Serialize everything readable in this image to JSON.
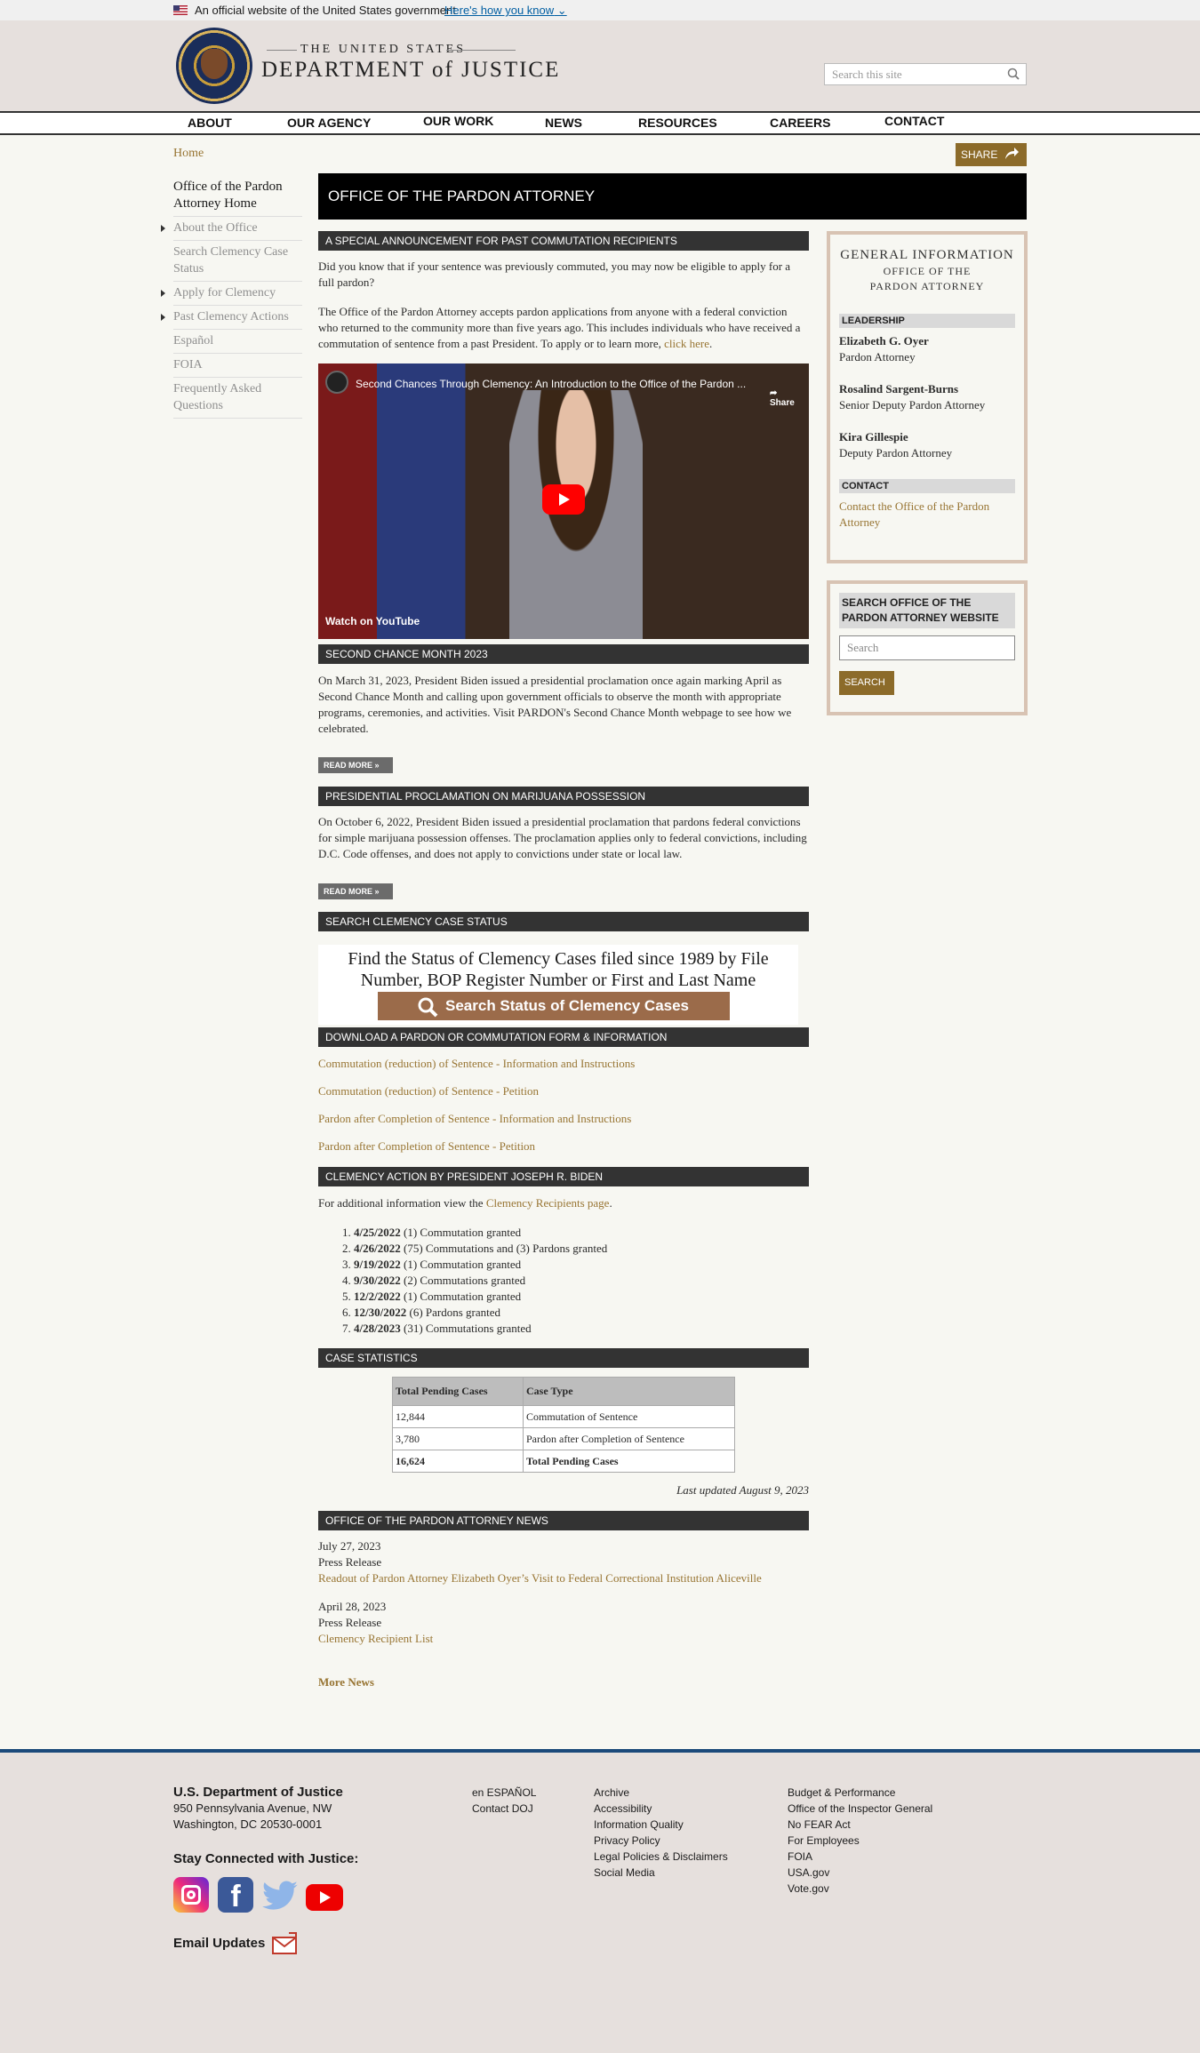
{
  "banner": {
    "text": "An official website of the United States government",
    "how": "Here's how you know"
  },
  "header": {
    "line1": "THE UNITED STATES",
    "line2": "DEPARTMENT of JUSTICE",
    "search_placeholder": "Search this site"
  },
  "nav": [
    "ABOUT",
    "OUR AGENCY",
    "OUR WORK",
    "NEWS",
    "RESOURCES",
    "CAREERS",
    "CONTACT"
  ],
  "breadcrumb": "Home",
  "share": "SHARE",
  "leftnav": [
    {
      "label": "Office of the Pardon Attorney Home",
      "arrow": false
    },
    {
      "label": "About the Office",
      "arrow": true
    },
    {
      "label": "Search Clemency Case Status",
      "arrow": false
    },
    {
      "label": "Apply for Clemency",
      "arrow": true
    },
    {
      "label": "Past Clemency Actions",
      "arrow": true
    },
    {
      "label": "Español",
      "arrow": false
    },
    {
      "label": "FOIA",
      "arrow": false
    },
    {
      "label": "Frequently Asked Questions",
      "arrow": false
    }
  ],
  "page_title": "OFFICE OF THE PARDON ATTORNEY",
  "announce": {
    "heading": "A SPECIAL ANNOUNCEMENT FOR PAST COMMUTATION RECIPIENTS",
    "p1": "Did you know that if your sentence was previously commuted, you may now be eligible to apply for a full pardon?",
    "p2": "The Office of the Pardon Attorney accepts pardon applications from anyone with a federal conviction who returned to the community more than five years ago. This includes individuals who have received a commutation of sentence from a past President. To apply or to learn more, ",
    "p2_link": "click here",
    "p2_end": "."
  },
  "video": {
    "title": "Second Chances Through Clemency: An Introduction to the Office of the Pardon ...",
    "share": "Share",
    "watch": "Watch on  YouTube"
  },
  "second_chance": {
    "heading": "SECOND CHANCE MONTH 2023",
    "text": "On March 31, 2023, President Biden issued a presidential proclamation once again marking April as Second Chance Month and calling upon government officials to observe the month with appropriate programs, ceremonies, and activities. Visit PARDON's Second Chance Month webpage to see how we celebrated.",
    "more": "READ MORE »"
  },
  "marijuana": {
    "heading": "PRESIDENTIAL PROCLAMATION ON MARIJUANA POSSESSION",
    "text": "On October 6, 2022, President Biden issued a presidential proclamation that pardons federal convictions for simple marijuana possession offenses. The proclamation applies only to federal convictions, including D.C. Code offenses, and does not apply to convictions under state or local law.",
    "more": "READ MORE »"
  },
  "case_status": {
    "heading": "SEARCH CLEMENCY CASE STATUS",
    "banner_text": "Find the Status of Clemency Cases filed since 1989 by File Number, BOP Register Number or First and Last Name",
    "button": "Search Status of Clemency Cases"
  },
  "forms": {
    "heading": "DOWNLOAD A PARDON OR COMMUTATION FORM & INFORMATION",
    "links": [
      "Commutation (reduction) of Sentence - Information and Instructions",
      "Commutation (reduction) of Sentence -  Petition",
      "Pardon after Completion of Sentence - Information and Instructions",
      "Pardon after Completion of Sentence - Petition"
    ]
  },
  "biden": {
    "heading": "CLEMENCY ACTION BY PRESIDENT JOSEPH R. BIDEN",
    "intro": "For additional information view the ",
    "intro_link": "Clemency Recipients page",
    "intro_end": ".",
    "items": [
      {
        "n": "1.",
        "date": "4/25/2022",
        "text": " (1) Commutation granted"
      },
      {
        "n": "2.",
        "date": "4/26/2022",
        "text": " (75) Commutations and (3) Pardons granted"
      },
      {
        "n": "3.",
        "date": "9/19/2022",
        "text": " (1) Commutation granted"
      },
      {
        "n": "4.",
        "date": "9/30/2022",
        "text": " (2) Commutations granted"
      },
      {
        "n": "5.",
        "date": "12/2/2022",
        "text": " (1) Commutation granted"
      },
      {
        "n": "6.",
        "date": "12/30/2022",
        "text": " (6) Pardons granted"
      },
      {
        "n": "7.",
        "date": "4/28/2023",
        "text": " (31) Commutations granted"
      }
    ]
  },
  "stats": {
    "heading": "CASE STATISTICS",
    "h1": "Total Pending Cases",
    "h2": "Case Type",
    "rows": [
      [
        "12,844",
        "Commutation of Sentence"
      ],
      [
        "3,780",
        "Pardon after Completion of Sentence"
      ],
      [
        "16,624",
        "Total Pending Cases"
      ]
    ],
    "updated": "Last updated August 9, 2023"
  },
  "news": {
    "heading": "OFFICE OF THE PARDON ATTORNEY NEWS",
    "items": [
      {
        "date": "July 27, 2023",
        "type": "Press Release",
        "title": "Readout of Pardon Attorney Elizabeth Oyer’s Visit to Federal Correctional Institution Aliceville"
      },
      {
        "date": "April 28, 2023",
        "type": "Press Release",
        "title": "Clemency Recipient List"
      }
    ],
    "more": "More News"
  },
  "sidebar": {
    "gi_title1": "GENERAL INFORMATION",
    "gi_title2": "OFFICE OF THE",
    "gi_title3": "PARDON ATTORNEY",
    "leadership": "LEADERSHIP",
    "leaders": [
      {
        "name": "Elizabeth G. Oyer",
        "title": "Pardon Attorney"
      },
      {
        "name": "Rosalind Sargent-Burns",
        "title": "Senior Deputy Pardon Attorney"
      },
      {
        "name": "Kira Gillespie",
        "title": "Deputy Pardon Attorney"
      }
    ],
    "contact": "CONTACT",
    "contact_link": "Contact the Office of the Pardon Attorney",
    "search_heading": "SEARCH OFFICE OF THE PARDON ATTORNEY WEBSITE",
    "search_placeholder": "Search",
    "search_button": "SEARCH"
  },
  "footer": {
    "org": "U.S. Department of Justice",
    "addr1": "950 Pennsylvania Avenue, NW",
    "addr2": "Washington, DC 20530-0001",
    "stay": "Stay Connected with Justice:",
    "email": "Email Updates",
    "col2": [
      "en ESPAÑOL",
      "Contact DOJ"
    ],
    "col3": [
      "Archive",
      "Accessibility",
      "Information Quality",
      "Privacy Policy",
      "Legal Policies & Disclaimers",
      "Social Media"
    ],
    "col4": [
      "Budget & Performance",
      "Office of the Inspector General",
      "No FEAR Act",
      "For Employees",
      "FOIA",
      "USA.gov",
      "Vote.gov"
    ]
  }
}
